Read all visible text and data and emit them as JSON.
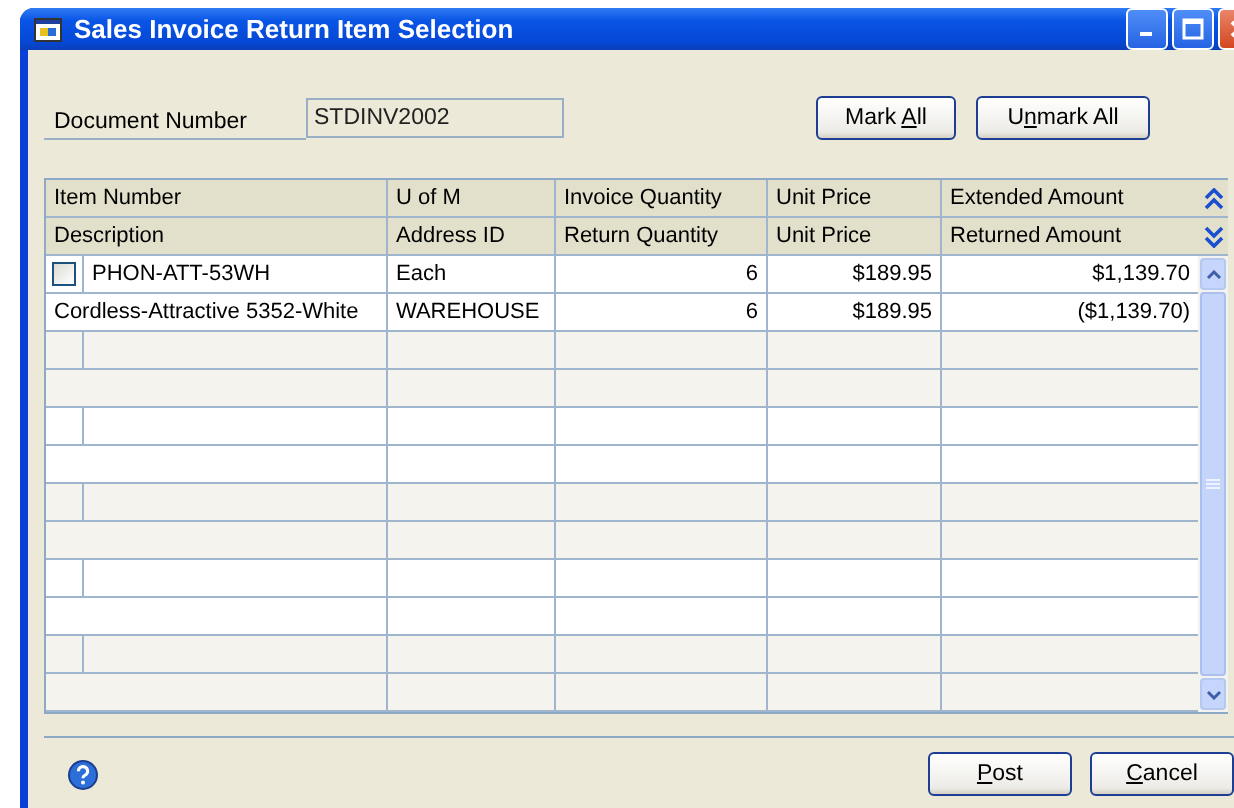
{
  "window": {
    "title": "Sales Invoice Return Item Selection"
  },
  "document_number": {
    "label": "Document Number",
    "value": "STDINV2002"
  },
  "mark_buttons": [
    {
      "before": "Mark ",
      "key": "A",
      "after": "ll"
    },
    {
      "before": "U",
      "key": "n",
      "after": "mark All"
    }
  ],
  "columns": {
    "line_1": [
      "Item Number",
      "U of M",
      "Invoice Quantity",
      "Unit Price",
      "Extended Amount"
    ],
    "line_2": [
      "Description",
      "Address ID",
      "Return Quantity",
      "Unit Price",
      "Returned Amount"
    ]
  },
  "items": [
    {
      "marked": false,
      "item_number": "PHON-ATT-53WH",
      "u_of_m": "Each",
      "invoice_quantity": "6",
      "unit_price": "$189.95",
      "extended_amount": "$1,139.70",
      "description": "Cordless-Attractive 5352-White",
      "address_id": "WAREHOUSE",
      "return_quantity": "6",
      "return_unit_price": "$189.95",
      "returned_amount": "($1,139.70)"
    }
  ],
  "footer_buttons": [
    {
      "key": "P",
      "after": "ost"
    },
    {
      "key": "C",
      "after": "ancel"
    }
  ]
}
